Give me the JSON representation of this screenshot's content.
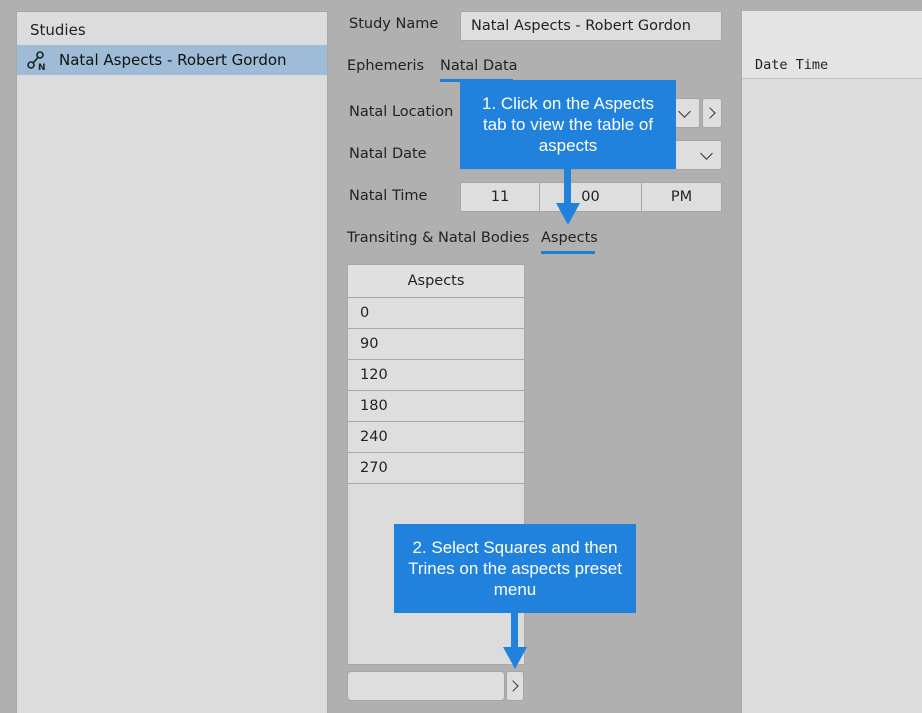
{
  "studies": {
    "title": "Studies",
    "items": [
      {
        "label": "Natal Aspects - Robert Gordon",
        "icon": "natal-chart-icon",
        "selected": true
      }
    ]
  },
  "form": {
    "study_name_label": "Study Name",
    "study_name_value": "Natal Aspects - Robert Gordon",
    "tabs": [
      "Ephemeris",
      "Natal Data"
    ],
    "active_tab": "Natal Data",
    "natal_location_label": "Natal Location",
    "natal_date_label": "Natal Date",
    "natal_time_label": "Natal Time",
    "natal_time_hour": "11",
    "natal_time_minute": "00",
    "natal_time_ampm": "PM",
    "sub_tabs": [
      "Transiting & Natal Bodies",
      "Aspects"
    ],
    "active_sub_tab": "Aspects"
  },
  "aspects_table": {
    "header": "Aspects",
    "rows": [
      "0",
      "90",
      "120",
      "180",
      "240",
      "270"
    ]
  },
  "right_panel": {
    "header": "Date Time"
  },
  "callouts": {
    "step1": "1. Click on the Aspects tab to view the table of aspects",
    "step2": "2. Select Squares and then Trines on the aspects preset menu"
  },
  "colors": {
    "accent": "#2082dc",
    "selection": "#9ebcd8",
    "background": "#b0b0b0"
  }
}
